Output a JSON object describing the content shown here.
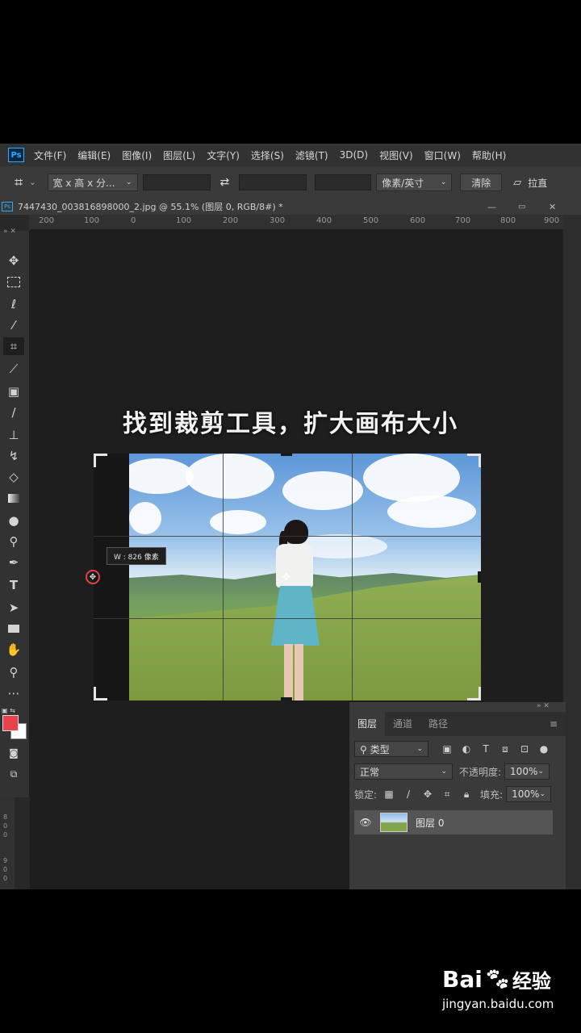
{
  "menu": {
    "logo": "Ps",
    "items": [
      "文件(F)",
      "编辑(E)",
      "图像(I)",
      "图层(L)",
      "文字(Y)",
      "选择(S)",
      "滤镜(T)",
      "3D(D)",
      "视图(V)",
      "窗口(W)",
      "帮助(H)"
    ]
  },
  "options": {
    "ratio": "宽 x 高 x 分...",
    "units": "像素/英寸",
    "clear": "清除",
    "straighten": "拉直"
  },
  "document": {
    "tab_title": "7447430_003816898000_2.jpg @ 55.1% (图层 0, RGB/8#) *"
  },
  "ruler": {
    "labels": [
      "200",
      "100",
      "0",
      "100",
      "200",
      "300",
      "400",
      "500",
      "600",
      "700",
      "800",
      "900"
    ]
  },
  "left_ruler": {
    "digits": [
      "8",
      "0",
      "0",
      "9",
      "0",
      "0"
    ]
  },
  "caption": "找到裁剪工具，扩大画布大小",
  "crop_tooltip": "W : 826 像素",
  "layers_panel": {
    "tabs": [
      "图层",
      "通道",
      "路径"
    ],
    "filter": "类型",
    "blend_mode": "正常",
    "opacity_label": "不透明度:",
    "opacity_value": "100%",
    "lock_label": "锁定:",
    "fill_label": "填充:",
    "fill_value": "100%",
    "layer_name": "图层 0"
  },
  "watermark": {
    "brand": "Bai",
    "brand2": "经验",
    "url": "jingyan.baidu.com"
  },
  "colors": {
    "foreground": "#e8434a",
    "background": "#ffffff",
    "ps_blue": "#31a8ff"
  }
}
